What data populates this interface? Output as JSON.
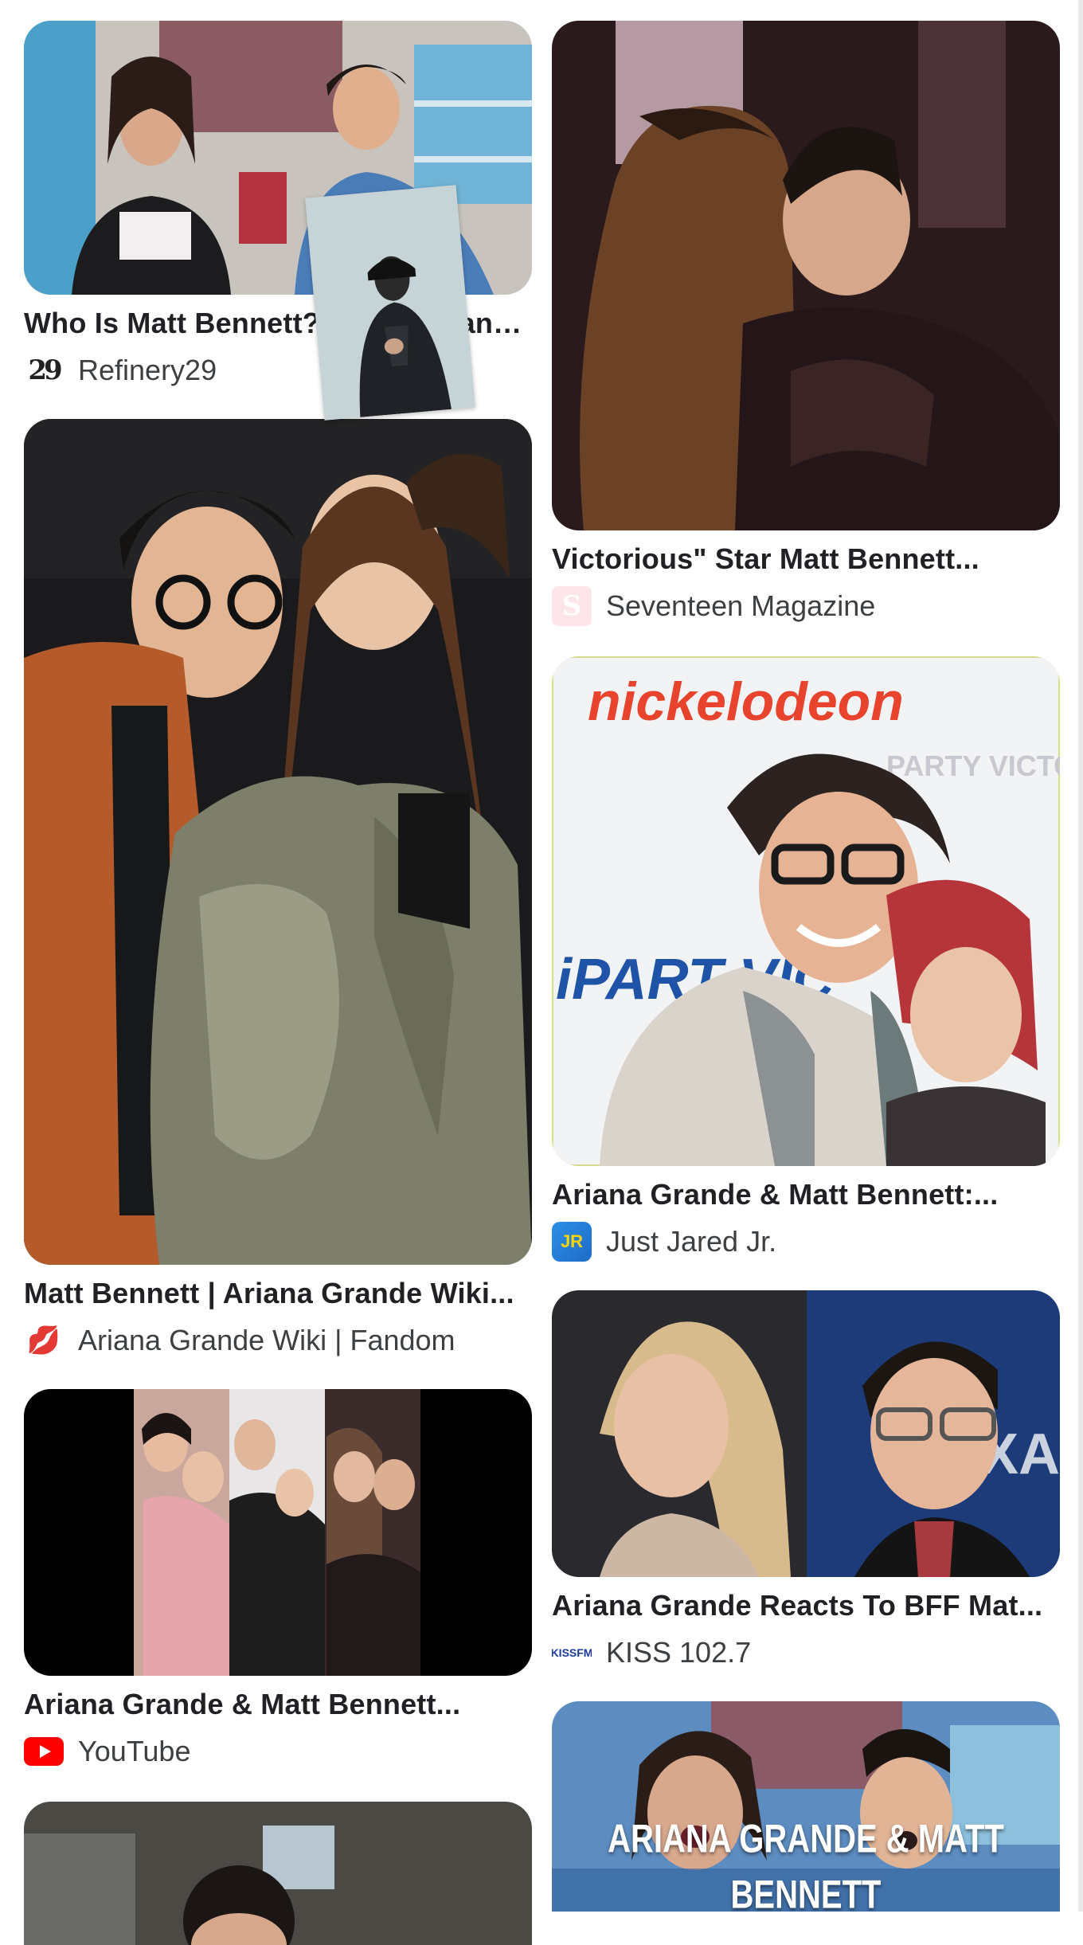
{
  "results": {
    "left": [
      {
        "title": "Who Is Matt Bennett? Ariana Grande...",
        "source": "Refinery29",
        "favicon": "refinery29-logo-icon",
        "favicon_text": "29"
      },
      {
        "title": "Matt Bennett | Ariana Grande Wiki...",
        "source": "Ariana Grande Wiki | Fandom",
        "favicon": "lips-icon"
      },
      {
        "title": "Ariana Grande & Matt Bennett...",
        "source": "YouTube",
        "favicon": "youtube-icon"
      },
      {
        "title": "",
        "source": ""
      }
    ],
    "right": [
      {
        "title": "Victorious\" Star Matt Bennett...",
        "source": "Seventeen Magazine",
        "favicon": "seventeen-icon",
        "favicon_text": "S"
      },
      {
        "title": "Ariana Grande & Matt Bennett:...",
        "source": "Just Jared Jr.",
        "favicon": "just-jared-jr-icon",
        "favicon_text": "JR",
        "image_text": {
          "logo": "nickelodeon",
          "poster_top": "PARTY VICTORIOUS",
          "poster_side": "iPART VIC"
        }
      },
      {
        "title": "Ariana Grande Reacts To BFF Mat...",
        "source": "KISS 102.7",
        "favicon": "kiss-fm-icon",
        "favicon_text": "KISSFM",
        "image_text": "PIXA ONWA"
      },
      {
        "title": "",
        "source": "",
        "image_text": "ARIANA GRANDE & MATT BENNETT"
      }
    ]
  },
  "colors": {
    "title": "#202124",
    "source": "#3c4043",
    "background": "#ffffff"
  }
}
